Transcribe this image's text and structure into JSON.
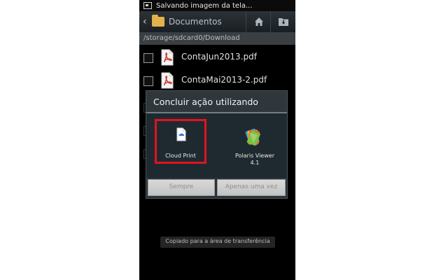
{
  "status_bar": {
    "notification_text": "Salvando imagem da tela..."
  },
  "action_bar": {
    "title": "Documentos",
    "icons": {
      "back": "back-icon",
      "folder": "folder-icon",
      "home": "home-icon",
      "download": "download-folder-icon"
    }
  },
  "path_bar": {
    "path": "/storage/sdcard0/Download"
  },
  "file_list": {
    "items": [
      {
        "name": "ContaJun2013.pdf",
        "icon": "pdf-icon"
      },
      {
        "name": "ContaMai2013-2.pdf",
        "icon": "pdf-icon"
      }
    ]
  },
  "dialog": {
    "title": "Concluir ação utilizando",
    "apps": [
      {
        "label": "Cloud Print",
        "icon": "cloud-print-icon",
        "highlighted": true,
        "highlight_color": "#e01420"
      },
      {
        "label": "Polaris Viewer\n4.1",
        "icon": "polaris-viewer-icon",
        "highlighted": false
      }
    ],
    "buttons": {
      "always_label": "Sempre",
      "once_label": "Apenas uma vez"
    }
  },
  "toast": {
    "text": "Copiado para a área de transferência"
  },
  "colors": {
    "highlight": "#e01420",
    "action_bar_bg": "#2b3338",
    "dialog_bg": "#2a3338",
    "apps_bg": "#1f2a30"
  }
}
